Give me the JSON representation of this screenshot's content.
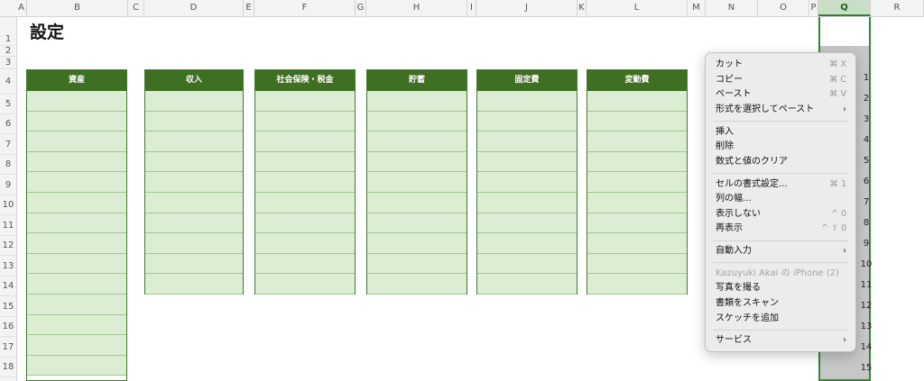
{
  "columns": [
    "A",
    "B",
    "C",
    "D",
    "E",
    "F",
    "G",
    "H",
    "I",
    "J",
    "K",
    "L",
    "M",
    "N",
    "O",
    "P",
    "Q",
    "R"
  ],
  "selected_column": "Q",
  "rows": [
    "1",
    "2",
    "3",
    "4",
    "5",
    "6",
    "7",
    "8",
    "9",
    "10",
    "11",
    "12",
    "13",
    "14",
    "15",
    "16",
    "17",
    "18"
  ],
  "sheet": {
    "title": "設定",
    "tables": [
      {
        "header": "資産"
      },
      {
        "header": "収入"
      },
      {
        "header": "社会保険・税金"
      },
      {
        "header": "貯蓄"
      },
      {
        "header": "固定費"
      },
      {
        "header": "変動費"
      }
    ]
  },
  "q_row_numbers": [
    "1",
    "2",
    "3",
    "4",
    "5",
    "6",
    "7",
    "8",
    "9",
    "10",
    "11",
    "12",
    "13",
    "14",
    "15"
  ],
  "context_menu": {
    "cut": {
      "label": "カット",
      "shortcut": "⌘ X"
    },
    "copy": {
      "label": "コピー",
      "shortcut": "⌘ C"
    },
    "paste": {
      "label": "ペースト",
      "shortcut": "⌘ V"
    },
    "paste_special": {
      "label": "形式を選択してペースト"
    },
    "insert": {
      "label": "挿入"
    },
    "delete": {
      "label": "削除"
    },
    "clear": {
      "label": "数式と値のクリア"
    },
    "format_cells": {
      "label": "セルの書式設定...",
      "shortcut": "⌘ 1"
    },
    "column_width": {
      "label": "列の幅..."
    },
    "hide": {
      "label": "表示しない",
      "shortcut": "^ 0"
    },
    "unhide": {
      "label": "再表示",
      "shortcut": "^ ⇧ 0"
    },
    "autofill": {
      "label": "自動入力"
    },
    "device": {
      "label": "Kazuyuki Akai の iPhone (2)"
    },
    "take_photo": {
      "label": "写真を撮る"
    },
    "scan_documents": {
      "label": "書類をスキャン"
    },
    "add_sketch": {
      "label": "スケッチを追加"
    },
    "services": {
      "label": "サービス"
    }
  }
}
